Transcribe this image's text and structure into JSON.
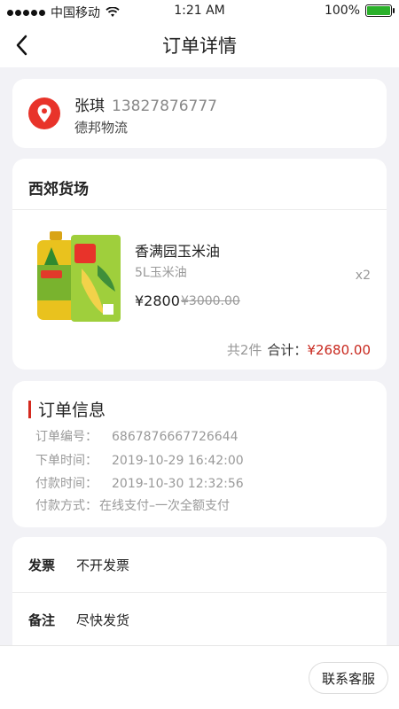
{
  "status_bar": {
    "carrier": "中国移动",
    "time": "1:21 AM",
    "battery": "100%",
    "battery_level": 1.0
  },
  "nav": {
    "title": "订单详情",
    "back_icon": "chevron-left-icon"
  },
  "address": {
    "name": "张琪",
    "phone": "13827876777",
    "line": "德邦物流",
    "icon": "location-pin-icon",
    "icon_color": "#e8332a"
  },
  "shop": {
    "name": "西郊货场",
    "product": {
      "title": "香满园玉米油",
      "spec": "5L玉米油",
      "quantity": "x2",
      "price": "¥2800",
      "original_price": "¥3000.00"
    },
    "summary": {
      "count": "共2件",
      "total_label": "合计：",
      "total": "¥2680.00"
    }
  },
  "order_info": {
    "title": "订单信息",
    "accent_color": "#d42a1f",
    "rows": [
      {
        "label": "订单编号：",
        "value": "6867876667726644"
      },
      {
        "label": "下单时间：",
        "value": "2019-10-29 16:42:00"
      },
      {
        "label": "付款时间：",
        "value": "2019-10-30 12:32:56"
      },
      {
        "label": "付款方式：",
        "value": "在线支付–一次全额支付"
      }
    ]
  },
  "extras": [
    {
      "key": "发票",
      "value": "不开发票"
    },
    {
      "key": "备注",
      "value": "尽快发货"
    }
  ],
  "bottom": {
    "service_button": "联系客服"
  }
}
